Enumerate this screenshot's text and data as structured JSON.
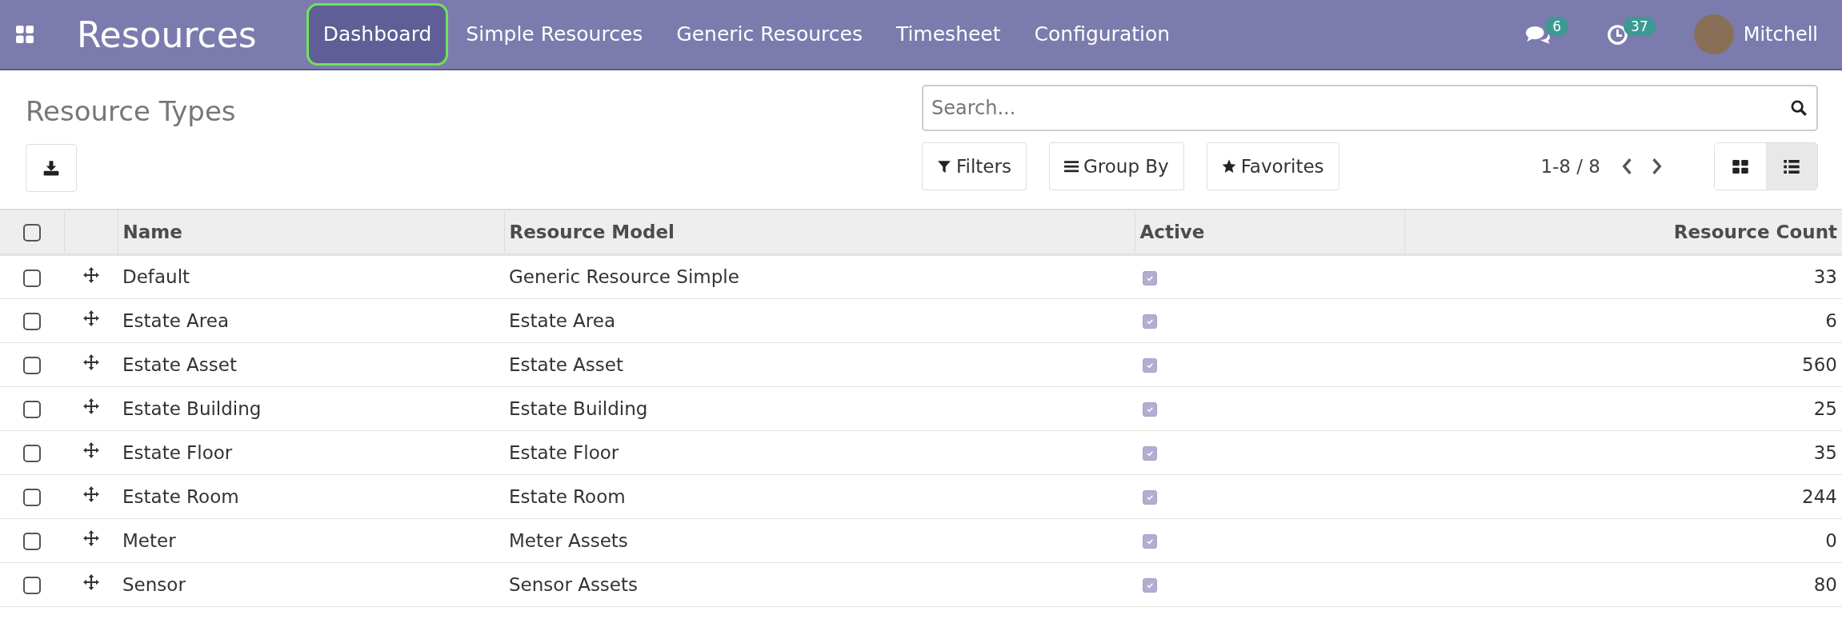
{
  "app_title": "Resources",
  "nav_items": [
    {
      "label": "Dashboard",
      "selected": true
    },
    {
      "label": "Simple Resources",
      "selected": false
    },
    {
      "label": "Generic Resources",
      "selected": false
    },
    {
      "label": "Timesheet",
      "selected": false
    },
    {
      "label": "Configuration",
      "selected": false
    }
  ],
  "messages_badge": "6",
  "activities_badge": "37",
  "user": "Mitchell",
  "page_title": "Resource Types",
  "search": {
    "placeholder": "Search..."
  },
  "filter_buttons": [
    {
      "kind": "filter",
      "label": "Filters"
    },
    {
      "kind": "group",
      "label": "Group By"
    },
    {
      "kind": "favorite",
      "label": "Favorites"
    }
  ],
  "pager": "1-8 / 8",
  "views": [
    {
      "kind": "kanban",
      "selected": false
    },
    {
      "kind": "list",
      "selected": true
    }
  ],
  "table": {
    "select_all": false,
    "columns": [
      "Name",
      "Resource Model",
      "Active",
      "Resource Count"
    ],
    "rows": [
      {
        "checked": false,
        "name": "Default",
        "model": "Generic Resource Simple",
        "active": true,
        "count": "33"
      },
      {
        "checked": false,
        "name": "Estate Area",
        "model": "Estate Area",
        "active": true,
        "count": "6"
      },
      {
        "checked": false,
        "name": "Estate Asset",
        "model": "Estate Asset",
        "active": true,
        "count": "560"
      },
      {
        "checked": false,
        "name": "Estate Building",
        "model": "Estate Building",
        "active": true,
        "count": "25"
      },
      {
        "checked": false,
        "name": "Estate Floor",
        "model": "Estate Floor",
        "active": true,
        "count": "35"
      },
      {
        "checked": false,
        "name": "Estate Room",
        "model": "Estate Room",
        "active": true,
        "count": "244"
      },
      {
        "checked": false,
        "name": "Meter",
        "model": "Meter Assets",
        "active": true,
        "count": "0"
      },
      {
        "checked": false,
        "name": "Sensor",
        "model": "Sensor Assets",
        "active": true,
        "count": "80"
      }
    ]
  }
}
